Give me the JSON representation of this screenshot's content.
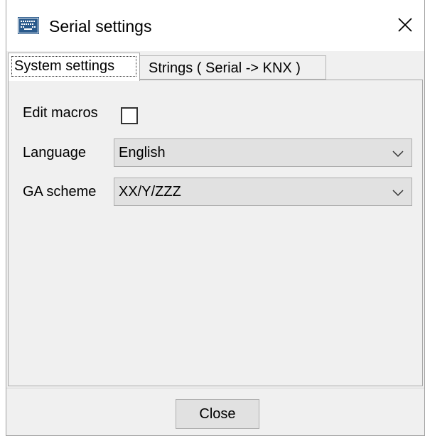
{
  "window": {
    "title": "Serial settings",
    "icon": "keyboard-window-icon",
    "close_icon": "close-icon"
  },
  "tabs": [
    {
      "label": "System settings",
      "active": true
    },
    {
      "label": "Strings ( Serial -> KNX )",
      "active": false
    }
  ],
  "system_settings": {
    "edit_macros": {
      "label": "Edit macros",
      "checked": false
    },
    "language": {
      "label": "Language",
      "value": "English"
    },
    "ga_scheme": {
      "label": "GA scheme",
      "value": "XX/Y/ZZZ"
    }
  },
  "footer": {
    "close_label": "Close"
  },
  "colors": {
    "window_bg": "#f0f0f0",
    "title_bg": "#ffffff",
    "control_bg": "#e1e1e1",
    "control_border": "#adadad",
    "icon_blue": "#2a5a8c"
  }
}
